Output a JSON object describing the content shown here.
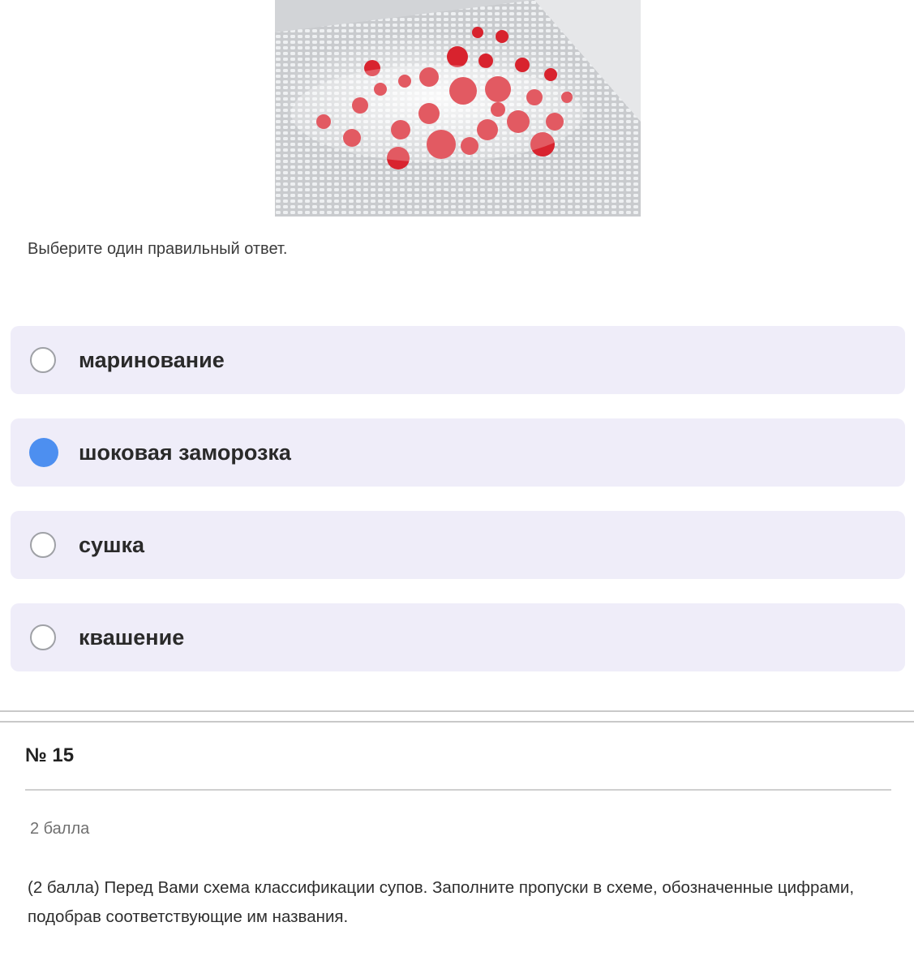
{
  "question": {
    "image": {
      "icon": "frozen-strawberries-photo"
    },
    "instruction": "Выберите один правильный ответ.",
    "options": [
      {
        "label": "маринование",
        "selected": false
      },
      {
        "label": "шоковая заморозка",
        "selected": true
      },
      {
        "label": "сушка",
        "selected": false
      },
      {
        "label": "квашение",
        "selected": false
      }
    ],
    "selected_color": "#4d8ff0",
    "option_background": "#efedf9"
  },
  "next_question": {
    "number": "№ 15",
    "points": "2 балла",
    "text": "(2 балла) Перед Вами схема классификации супов. Заполните пропуски в схеме, обозначенные цифрами, подобрав соответствующие им названия."
  }
}
